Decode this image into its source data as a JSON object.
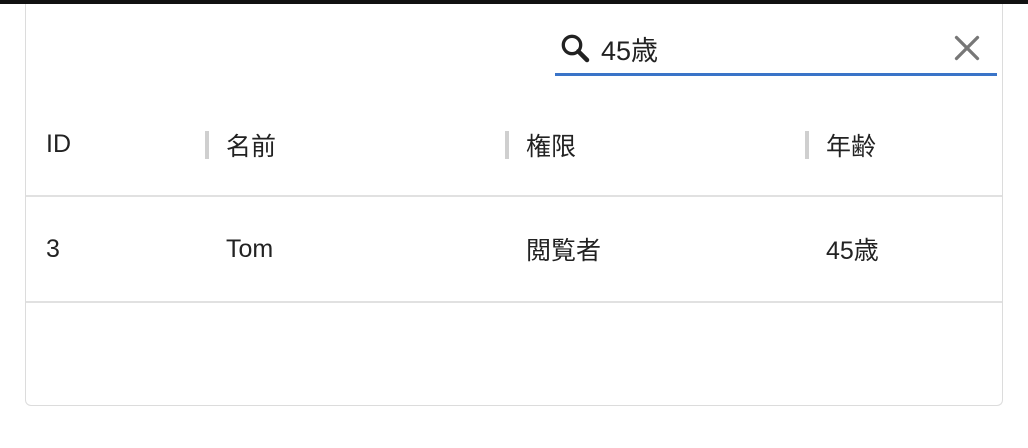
{
  "search": {
    "value": "45歳",
    "icon": "search-icon",
    "clear_icon": "close-icon",
    "accent_color": "#3a74c8"
  },
  "table": {
    "columns": [
      "ID",
      "名前",
      "権限",
      "年齢"
    ],
    "rows": [
      [
        "3",
        "Tom",
        "閲覧者",
        "45歳"
      ]
    ]
  }
}
